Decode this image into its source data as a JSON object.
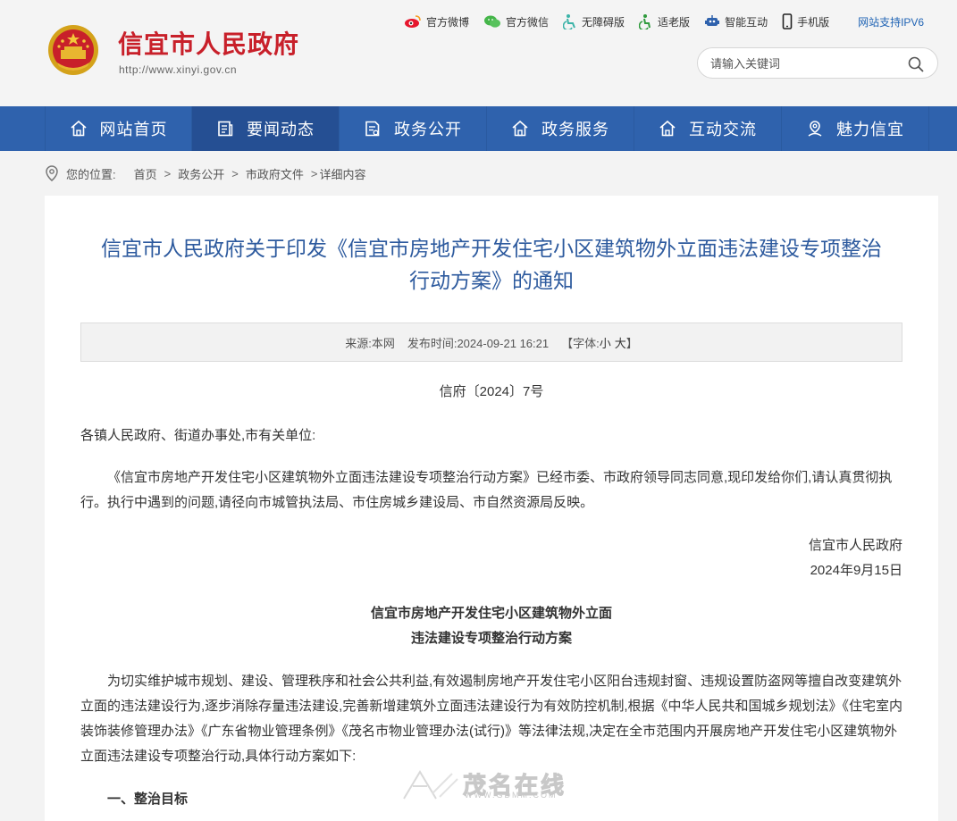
{
  "header": {
    "site_name": "信宜市人民政府",
    "site_url": "http://www.xinyi.gov.cn",
    "toplinks": [
      {
        "label": "官方微博",
        "icon": "weibo-icon"
      },
      {
        "label": "官方微信",
        "icon": "wechat-icon"
      },
      {
        "label": "无障碍版",
        "icon": "accessibility-icon"
      },
      {
        "label": "适老版",
        "icon": "elderly-icon"
      },
      {
        "label": "智能互动",
        "icon": "robot-icon"
      },
      {
        "label": "手机版",
        "icon": "mobile-icon"
      }
    ],
    "ipv6": "网站支持IPV6",
    "search_placeholder": "请输入关键词"
  },
  "nav": [
    {
      "label": "网站首页",
      "icon": "home-icon"
    },
    {
      "label": "要闻动态",
      "icon": "news-icon",
      "active": true
    },
    {
      "label": "政务公开",
      "icon": "document-icon"
    },
    {
      "label": "政务服务",
      "icon": "home-icon"
    },
    {
      "label": "互动交流",
      "icon": "home-icon"
    },
    {
      "label": "魅力信宜",
      "icon": "location-icon"
    }
  ],
  "breadcrumb": {
    "prefix": "您的位置:",
    "items": [
      "首页",
      "政务公开",
      "市政府文件"
    ],
    "last": "详细内容"
  },
  "article": {
    "title_line1": "信宜市人民政府关于印发《信宜市房地产开发住宅小区建筑物外立面违法建设专项整治",
    "title_line2": "行动方案》的通知",
    "meta": {
      "source": "来源:本网",
      "date": "发布时间:2024-09-21 16:21",
      "font_open": "【字体:",
      "font_small": "小",
      "font_large": "大",
      "font_close": "】"
    },
    "doc_number": "信府〔2024〕7号",
    "salutation": "各镇人民政府、街道办事处,市有关单位:",
    "body1": "《信宜市房地产开发住宅小区建筑物外立面违法建设专项整治行动方案》已经市委、市政府领导同志同意,现印发给你们,请认真贯彻执行。执行中遇到的问题,请径向市城管执法局、市住房城乡建设局、市自然资源局反映。",
    "signature": "信宜市人民政府",
    "sign_date": "2024年9月15日",
    "sub_title_1": "信宜市房地产开发住宅小区建筑物外立面",
    "sub_title_2": "违法建设专项整治行动方案",
    "body2": "为切实维护城市规划、建设、管理秩序和社会公共利益,有效遏制房地产开发住宅小区阳台违规封窗、违规设置防盗网等擅自改变建筑外立面的违法建设行为,逐步消除存量违法建设,完善新增建筑外立面违法建设行为有效防控机制,根据《中华人民共和国城乡规划法》《住宅室内装饰装修管理办法》《广东省物业管理条例》《茂名市物业管理办法(试行)》等法律法规,决定在全市范围内开展房地产开发住宅小区建筑物外立面违法建设专项整治行动,具体行动方案如下:",
    "section1": "一、整治目标"
  },
  "watermark": {
    "text": "茂名在线",
    "sub": "WWW.GDMM.COM"
  },
  "colors": {
    "nav": "#2f62ad",
    "title": "#2d5a9e",
    "brand_red": "#c8202a"
  }
}
